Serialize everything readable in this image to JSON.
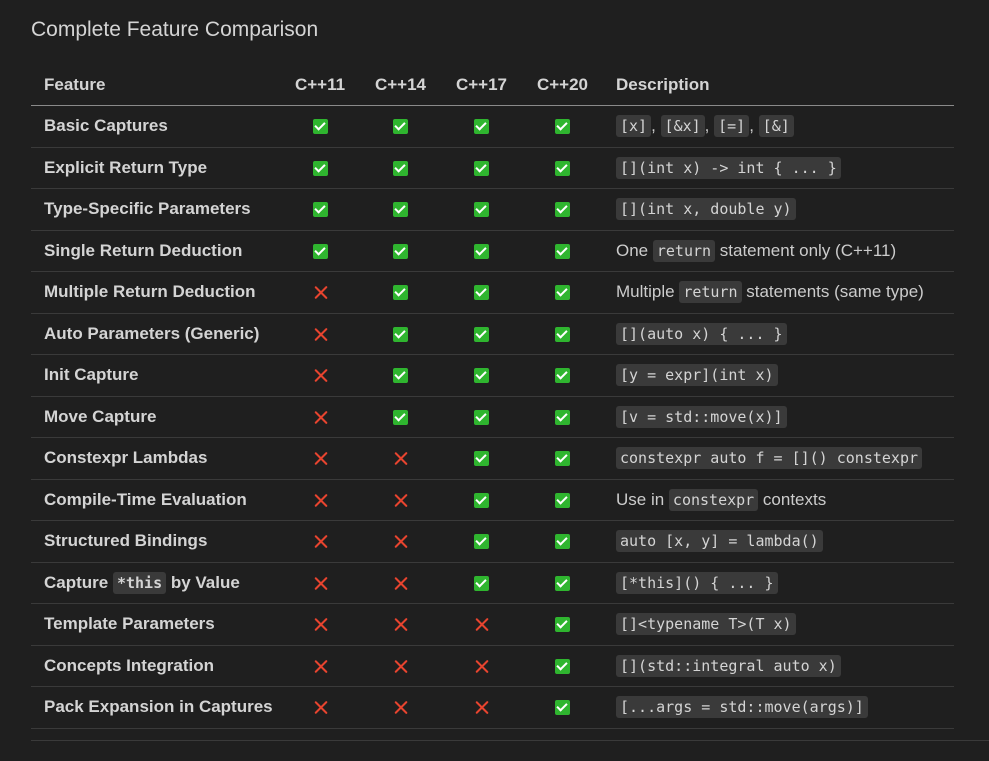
{
  "title": "Complete Feature Comparison",
  "headers": {
    "feature": "Feature",
    "versions": [
      "C++11",
      "C++14",
      "C++17",
      "C++20"
    ],
    "description": "Description"
  },
  "rows": [
    {
      "feature": [
        {
          "t": "Basic Captures"
        }
      ],
      "support": [
        true,
        true,
        true,
        true
      ],
      "desc": [
        {
          "c": "[x]"
        },
        {
          "t": ", "
        },
        {
          "c": "[&x]"
        },
        {
          "t": ", "
        },
        {
          "c": "[=]"
        },
        {
          "t": ", "
        },
        {
          "c": "[&]"
        }
      ]
    },
    {
      "feature": [
        {
          "t": "Explicit Return Type"
        }
      ],
      "support": [
        true,
        true,
        true,
        true
      ],
      "desc": [
        {
          "c": "[](int x) -> int { ... }"
        }
      ]
    },
    {
      "feature": [
        {
          "t": "Type-Specific Parameters"
        }
      ],
      "support": [
        true,
        true,
        true,
        true
      ],
      "desc": [
        {
          "c": "[](int x, double y)"
        }
      ]
    },
    {
      "feature": [
        {
          "t": "Single Return Deduction"
        }
      ],
      "support": [
        true,
        true,
        true,
        true
      ],
      "desc": [
        {
          "t": "One "
        },
        {
          "c": "return"
        },
        {
          "t": " statement only (C++11)"
        }
      ]
    },
    {
      "feature": [
        {
          "t": "Multiple Return Deduction"
        }
      ],
      "support": [
        false,
        true,
        true,
        true
      ],
      "desc": [
        {
          "t": "Multiple "
        },
        {
          "c": "return"
        },
        {
          "t": " statements (same type)"
        }
      ]
    },
    {
      "feature": [
        {
          "t": "Auto Parameters (Generic)"
        }
      ],
      "support": [
        false,
        true,
        true,
        true
      ],
      "desc": [
        {
          "c": "[](auto x) { ... }"
        }
      ]
    },
    {
      "feature": [
        {
          "t": "Init Capture"
        }
      ],
      "support": [
        false,
        true,
        true,
        true
      ],
      "desc": [
        {
          "c": "[y = expr](int x)"
        }
      ]
    },
    {
      "feature": [
        {
          "t": "Move Capture"
        }
      ],
      "support": [
        false,
        true,
        true,
        true
      ],
      "desc": [
        {
          "c": "[v = std::move(x)]"
        }
      ]
    },
    {
      "feature": [
        {
          "t": "Constexpr Lambdas"
        }
      ],
      "support": [
        false,
        false,
        true,
        true
      ],
      "desc": [
        {
          "c": "constexpr auto f = []() constexpr"
        }
      ]
    },
    {
      "feature": [
        {
          "t": "Compile-Time Evaluation"
        }
      ],
      "support": [
        false,
        false,
        true,
        true
      ],
      "desc": [
        {
          "t": "Use in "
        },
        {
          "c": "constexpr"
        },
        {
          "t": " contexts"
        }
      ]
    },
    {
      "feature": [
        {
          "t": "Structured Bindings"
        }
      ],
      "support": [
        false,
        false,
        true,
        true
      ],
      "desc": [
        {
          "c": "auto [x, y] = lambda()"
        }
      ]
    },
    {
      "feature": [
        {
          "t": "Capture "
        },
        {
          "c": "*this"
        },
        {
          "t": " by Value"
        }
      ],
      "support": [
        false,
        false,
        true,
        true
      ],
      "desc": [
        {
          "c": "[*this]() { ... }"
        }
      ]
    },
    {
      "feature": [
        {
          "t": "Template Parameters"
        }
      ],
      "support": [
        false,
        false,
        false,
        true
      ],
      "desc": [
        {
          "c": "[]<typename T>(T x)"
        }
      ]
    },
    {
      "feature": [
        {
          "t": "Concepts Integration"
        }
      ],
      "support": [
        false,
        false,
        false,
        true
      ],
      "desc": [
        {
          "c": "[](std::integral auto x)"
        }
      ]
    },
    {
      "feature": [
        {
          "t": "Pack Expansion in Captures"
        }
      ],
      "support": [
        false,
        false,
        false,
        true
      ],
      "desc": [
        {
          "c": "[...args = std::move(args)]"
        }
      ]
    }
  ],
  "icons": {
    "supported": "check-icon",
    "unsupported": "cross-icon"
  },
  "colors": {
    "check": "#2fb52f",
    "cross": "#e8442f"
  }
}
